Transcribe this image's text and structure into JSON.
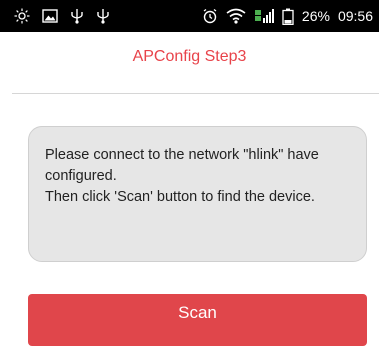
{
  "status_bar": {
    "battery_percent": "26%",
    "time": "09:56",
    "left_icons": [
      "brightness-icon",
      "image-icon",
      "usb-icon",
      "usb-icon"
    ],
    "right_icons": [
      "alarm-icon",
      "wifi-icon",
      "signal-icon",
      "battery-icon"
    ]
  },
  "header": {
    "title": "APConfig Step3"
  },
  "message": {
    "line1": "Please connect to the network \"hlink\" have configured.",
    "line2": "Then click 'Scan' button to find the device."
  },
  "actions": {
    "scan_label": "Scan"
  },
  "colors": {
    "accent": "#e0464b",
    "title": "#e8434a",
    "message_bg": "#e6e6e6"
  }
}
